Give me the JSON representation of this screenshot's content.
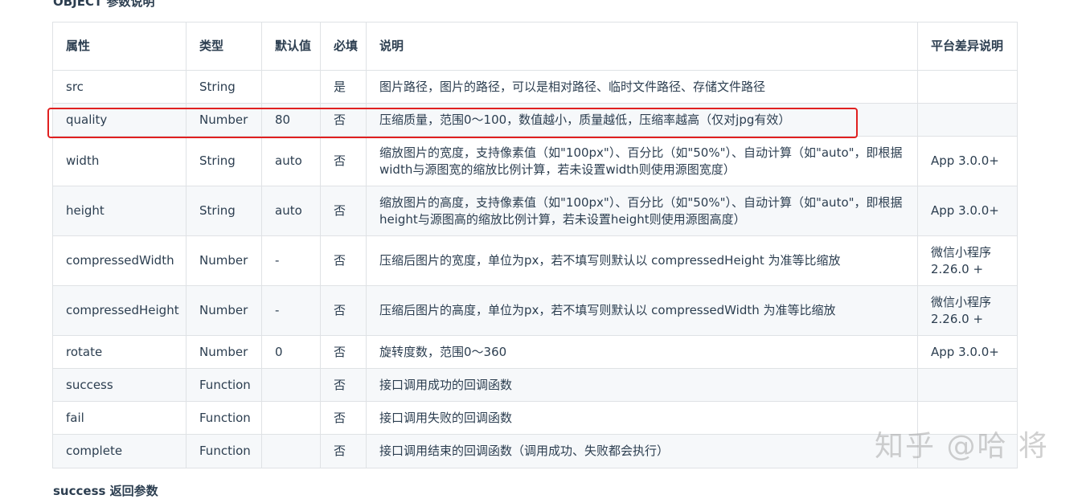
{
  "section_title": "OBJECT 参数说明",
  "next_section_title": "success 返回参数",
  "table": {
    "headers": [
      "属性",
      "类型",
      "默认值",
      "必填",
      "说明",
      "平台差异说明"
    ],
    "rows": [
      {
        "name": "src",
        "type": "String",
        "default": "",
        "required": "是",
        "desc": "图片路径，图片的路径，可以是相对路径、临时文件路径、存储文件路径",
        "platform": ""
      },
      {
        "name": "quality",
        "type": "Number",
        "default": "80",
        "required": "否",
        "desc": "压缩质量，范围0～100，数值越小，质量越低，压缩率越高（仅对jpg有效）",
        "platform": ""
      },
      {
        "name": "width",
        "type": "String",
        "default": "auto",
        "required": "否",
        "desc": "缩放图片的宽度，支持像素值（如\"100px\"）、百分比（如\"50%\"）、自动计算（如\"auto\"，即根据width与源图宽的缩放比例计算，若未设置width则使用源图宽度）",
        "platform": "App 3.0.0+"
      },
      {
        "name": "height",
        "type": "String",
        "default": "auto",
        "required": "否",
        "desc": "缩放图片的高度，支持像素值（如\"100px\"）、百分比（如\"50%\"）、自动计算（如\"auto\"，即根据height与源图高的缩放比例计算，若未设置height则使用源图高度）",
        "platform": "App 3.0.0+"
      },
      {
        "name": "compressedWidth",
        "type": "Number",
        "default": "-",
        "required": "否",
        "desc": "压缩后图片的宽度，单位为px，若不填写则默认以 compressedHeight 为准等比缩放",
        "platform": "微信小程序 2.26.0 +"
      },
      {
        "name": "compressedHeight",
        "type": "Number",
        "default": "-",
        "required": "否",
        "desc": "压缩后图片的高度，单位为px，若不填写则默认以 compressedWidth 为准等比缩放",
        "platform": "微信小程序 2.26.0 +"
      },
      {
        "name": "rotate",
        "type": "Number",
        "default": "0",
        "required": "否",
        "desc": "旋转度数，范围0～360",
        "platform": "App 3.0.0+"
      },
      {
        "name": "success",
        "type": "Function",
        "default": "",
        "required": "否",
        "desc": "接口调用成功的回调函数",
        "platform": ""
      },
      {
        "name": "fail",
        "type": "Function",
        "default": "",
        "required": "否",
        "desc": "接口调用失败的回调函数",
        "platform": ""
      },
      {
        "name": "complete",
        "type": "Function",
        "default": "",
        "required": "否",
        "desc": "接口调用结束的回调函数（调用成功、失败都会执行）",
        "platform": ""
      }
    ]
  },
  "highlight_color": "#e02020",
  "watermark": "知乎 @哈 将"
}
